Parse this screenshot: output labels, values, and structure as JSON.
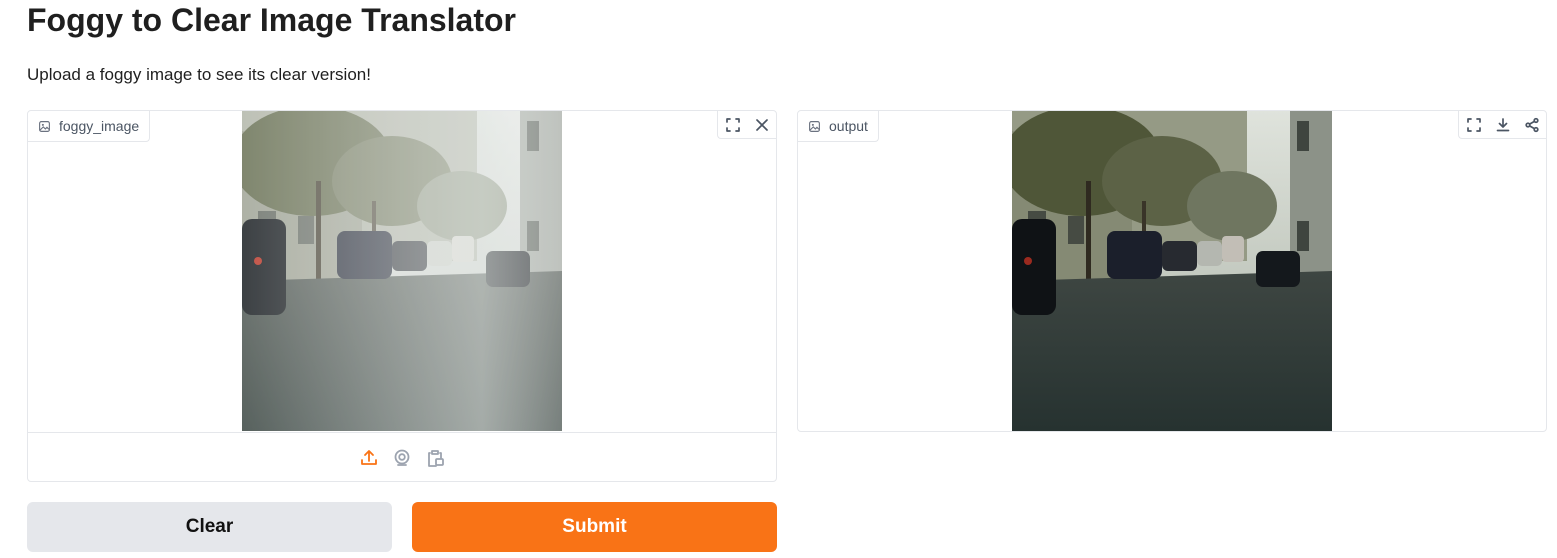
{
  "header": {
    "title": "Foggy to Clear Image Translator",
    "description": "Upload a foggy image to see its clear version!"
  },
  "input_panel": {
    "label": "foggy_image",
    "label_icon": "image-icon",
    "tools": [
      "fullscreen-icon",
      "close-icon"
    ],
    "sources": [
      "upload-icon",
      "webcam-icon",
      "clipboard-icon"
    ],
    "active_source": "upload-icon"
  },
  "output_panel": {
    "label": "output",
    "label_icon": "image-icon",
    "tools": [
      "fullscreen-icon",
      "download-icon",
      "share-icon"
    ]
  },
  "buttons": {
    "clear_label": "Clear",
    "submit_label": "Submit"
  },
  "colors": {
    "accent": "#f97316",
    "secondary_button": "#e5e7eb",
    "border": "#e5e7eb"
  }
}
